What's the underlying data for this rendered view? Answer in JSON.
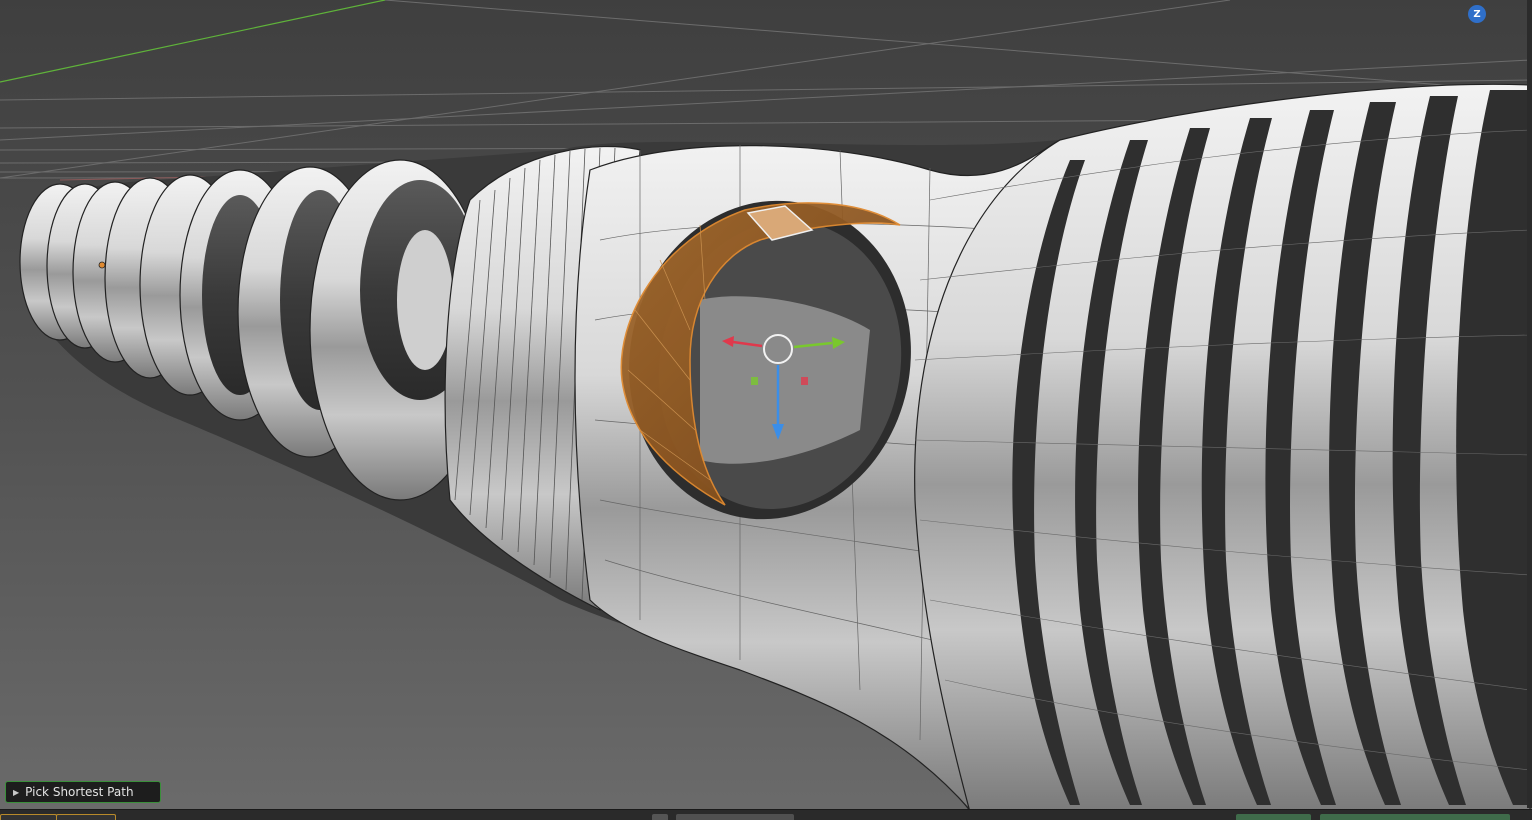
{
  "viewport": {
    "navigation_gizmo": {
      "axis_label": "Z",
      "icon": "z-axis-icon"
    },
    "object_origin_icon": "origin-dot-icon",
    "transform_gizmo": {
      "icon": "transform-gizmo-icon"
    },
    "selected_face_color": "#b8752e",
    "background_color": "#3d3d3d"
  },
  "operator_panel": {
    "label": "Pick Shortest Path",
    "expand_icon": "triangle-right-icon"
  },
  "colors": {
    "x_axis": "#e0394c",
    "y_axis": "#79c82d",
    "z_axis": "#3b8ee8",
    "panel_border": "#3a8f3a"
  }
}
